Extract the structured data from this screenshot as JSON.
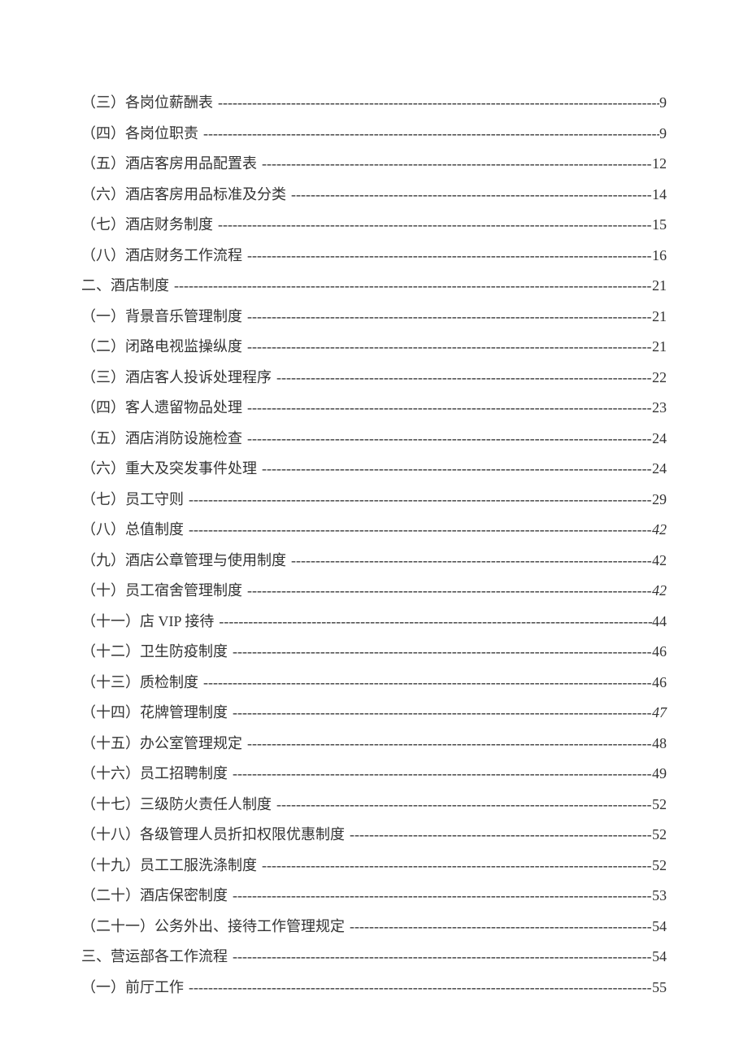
{
  "toc": [
    {
      "label": "（三）各岗位薪酬表",
      "page": "9",
      "italic": false
    },
    {
      "label": "（四）各岗位职责",
      "page": "9",
      "italic": false
    },
    {
      "label": "（五）酒店客房用品配置表",
      "page": "12",
      "italic": false
    },
    {
      "label": "（六）酒店客房用品标准及分类",
      "page": "14",
      "italic": false
    },
    {
      "label": "（七）酒店财务制度",
      "page": "15",
      "italic": false
    },
    {
      "label": "（八）酒店财务工作流程",
      "page": "16",
      "italic": false
    },
    {
      "label": "二、酒店制度",
      "page": "21",
      "italic": false
    },
    {
      "label": "（一）背景音乐管理制度",
      "page": "21",
      "italic": false
    },
    {
      "label": "（二）闭路电视监操纵度",
      "page": "21",
      "italic": false
    },
    {
      "label": "（三）酒店客人投诉处理程序",
      "page": "22",
      "italic": false
    },
    {
      "label": "（四）客人遗留物品处理",
      "page": "23",
      "italic": false
    },
    {
      "label": "（五）酒店消防设施检查",
      "page": "24",
      "italic": false
    },
    {
      "label": "（六）重大及突发事件处理",
      "page": "24",
      "italic": false
    },
    {
      "label": "（七）员工守则",
      "page": "29",
      "italic": false
    },
    {
      "label": "（八）总值制度",
      "page": "42",
      "italic": true
    },
    {
      "label": "（九）酒店公章管理与使用制度",
      "page": "42",
      "italic": false
    },
    {
      "label": "（十）员工宿舍管理制度",
      "page": "42",
      "italic": true
    },
    {
      "label": "（十一）店 VIP 接待",
      "page": "44",
      "italic": false
    },
    {
      "label": "（十二）卫生防疫制度",
      "page": "46",
      "italic": false
    },
    {
      "label": "（十三）质检制度",
      "page": "46",
      "italic": false
    },
    {
      "label": "（十四）花牌管理制度",
      "page": "47",
      "italic": true
    },
    {
      "label": "（十五）办公室管理规定",
      "page": "48",
      "italic": false
    },
    {
      "label": "（十六）员工招聘制度",
      "page": "49",
      "italic": false
    },
    {
      "label": "（十七）三级防火责任人制度",
      "page": "52",
      "italic": false
    },
    {
      "label": "（十八）各级管理人员折扣权限优惠制度",
      "page": "52",
      "italic": false
    },
    {
      "label": "（十九）员工工服洗涤制度",
      "page": "52",
      "italic": false
    },
    {
      "label": "（二十）酒店保密制度",
      "page": "53",
      "italic": false
    },
    {
      "label": "（二十一）公务外出、接待工作管理规定",
      "page": "54",
      "italic": false
    },
    {
      "label": "三、营运部各工作流程",
      "page": "54",
      "italic": false
    },
    {
      "label": "（一）前厅工作",
      "page": "55",
      "italic": false
    }
  ]
}
